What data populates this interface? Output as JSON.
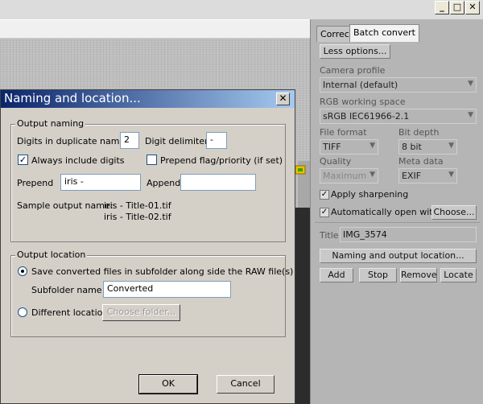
{
  "window": {
    "minimize_label": "_",
    "maximize_label": "□",
    "close_label": "✕"
  },
  "panel": {
    "tabs": [
      "Correct",
      "Batch convert"
    ],
    "less_options_label": "Less options...",
    "camera_profile_label": "Camera profile",
    "camera_profile_value": "Internal (default)",
    "rgb_space_label": "RGB working space",
    "rgb_space_value": "sRGB IEC61966-2.1",
    "file_format_label": "File format",
    "file_format_value": "TIFF",
    "bit_depth_label": "Bit depth",
    "bit_depth_value": "8 bit",
    "quality_label": "Quality",
    "quality_value": "Maximum",
    "meta_label": "Meta data",
    "meta_value": "EXIF",
    "apply_sharpening_label": "Apply sharpening",
    "apply_sharpening_checked": true,
    "auto_open_label": "Automatically open with:",
    "auto_open_checked": true,
    "choose_label": "Choose...",
    "title_label": "Title",
    "title_value": "IMG_3574",
    "naming_button_label": "Naming and output location...",
    "action_buttons": [
      "Add",
      "Stop",
      "Remove",
      "Locate"
    ]
  },
  "dialog": {
    "title": "Naming and location...",
    "close_label": "✕",
    "output_naming": {
      "legend": "Output naming",
      "digits_label": "Digits in duplicate names",
      "digits_value": "2",
      "delimiter_label": "Digit delimiter",
      "delimiter_value": "-",
      "always_digits_label": "Always include digits",
      "always_digits_checked": true,
      "prepend_flag_label": "Prepend flag/priority (if set)",
      "prepend_flag_checked": false,
      "prepend_label": "Prepend",
      "prepend_value": "iris -",
      "append_label": "Append",
      "append_value": "",
      "sample_label": "Sample output name:",
      "sample_lines": [
        "iris - Title-01.tif",
        "iris - Title-02.tif"
      ]
    },
    "output_location": {
      "legend": "Output location",
      "subfolder_option_label": "Save converted files in subfolder along side the RAW file(s)",
      "subfolder_selected": true,
      "subfolder_name_label": "Subfolder name",
      "subfolder_name_value": "Converted",
      "different_location_label": "Different location",
      "choose_folder_label": "Choose folder..."
    },
    "ok_label": "OK",
    "cancel_label": "Cancel"
  }
}
